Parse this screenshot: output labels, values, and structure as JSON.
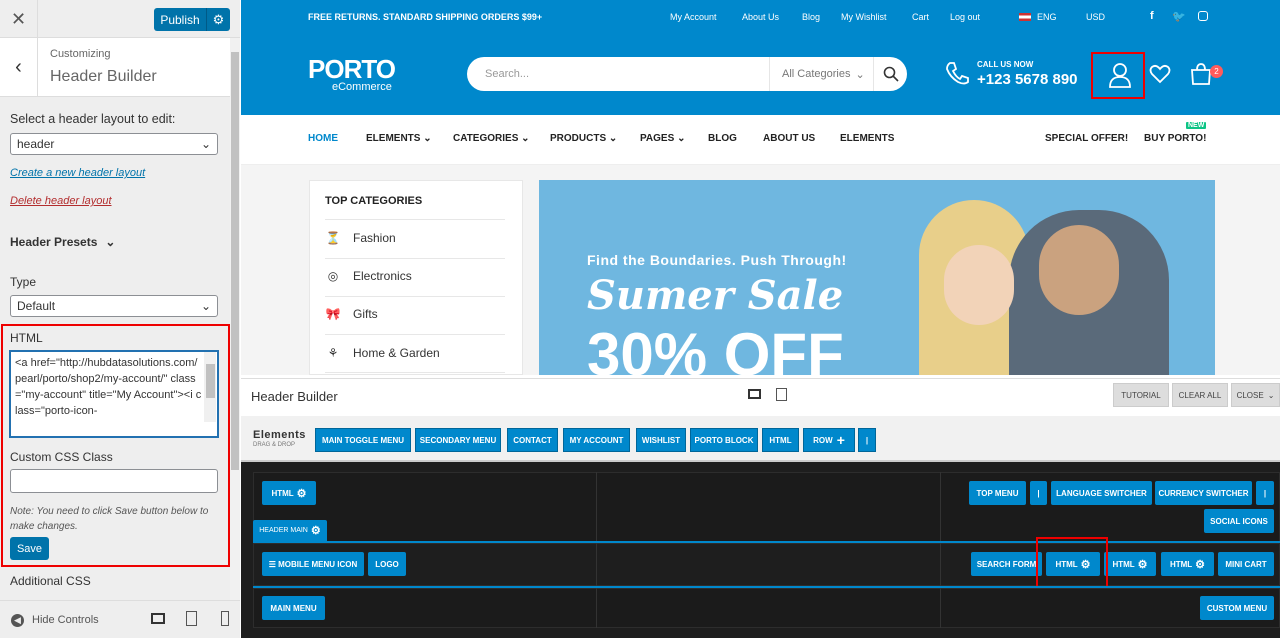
{
  "sidebar": {
    "close": "✕",
    "publish": "Publish",
    "customizing": "Customizing",
    "title": "Header Builder",
    "select_label": "Select a header layout to edit:",
    "layout_value": "header",
    "create_link": "Create a new header layout",
    "delete_link": "Delete header layout",
    "presets": "Header Presets",
    "type_label": "Type",
    "type_value": "Default",
    "html_label": "HTML",
    "html_value": "<a href=\"http://hubdatasolutions.com/pearl/porto/shop2/my-account/\" class=\"my-account\" title=\"My Account\"><i class=\"porto-icon-",
    "css_class_label": "Custom CSS Class",
    "note": "Note: You need to click Save button below to make changes.",
    "save": "Save",
    "additional_css": "Additional CSS",
    "hide_controls": "Hide Controls"
  },
  "topbar": {
    "promo": "FREE RETURNS. STANDARD SHIPPING ORDERS $99+",
    "links": [
      "My Account",
      "About Us",
      "Blog",
      "My Wishlist",
      "Cart",
      "Log out"
    ],
    "lang": "ENG",
    "currency": "USD"
  },
  "header": {
    "logo": "PORTO",
    "logo_sub": "eCommerce",
    "search_placeholder": "Search...",
    "search_category": "All Categories",
    "call_label": "CALL US NOW",
    "phone": "+123 5678 890",
    "cart_count": "2"
  },
  "nav": {
    "items": [
      "HOME",
      "ELEMENTS",
      "CATEGORIES",
      "PRODUCTS",
      "PAGES",
      "BLOG",
      "ABOUT US",
      "ELEMENTS"
    ],
    "special": "SPECIAL OFFER!",
    "buy": "BUY PORTO!",
    "new_badge": "NEW"
  },
  "categories": {
    "title": "TOP CATEGORIES",
    "items": [
      "Fashion",
      "Electronics",
      "Gifts",
      "Home & Garden"
    ]
  },
  "banner": {
    "sub": "Find the Boundaries. Push Through!",
    "sale": "Sumer Sale",
    "off": "30% OFF"
  },
  "builder": {
    "title": "Header Builder",
    "tutorial": "TUTORIAL",
    "clear_all": "CLEAR ALL",
    "close": "CLOSE",
    "elements_title": "Elements",
    "elements_sub": "DRAG & DROP",
    "elements": [
      "MAIN TOGGLE MENU",
      "SECONDARY MENU",
      "CONTACT",
      "MY ACCOUNT",
      "WISHLIST",
      "PORTO BLOCK",
      "HTML",
      "ROW",
      "|"
    ],
    "top_row": {
      "left": "HTML",
      "right": [
        "TOP MENU",
        "|",
        "LANGUAGE SWITCHER",
        "CURRENCY SWITCHER",
        "|",
        "SOCIAL ICONS"
      ]
    },
    "main_label": "HEADER MAIN",
    "main_row": {
      "left": [
        "☰ MOBILE MENU ICON",
        "LOGO"
      ],
      "right": [
        "SEARCH FORM",
        "HTML",
        "HTML",
        "HTML",
        "MINI CART"
      ]
    },
    "bottom_row": {
      "left": "MAIN MENU",
      "right": "CUSTOM MENU"
    }
  }
}
